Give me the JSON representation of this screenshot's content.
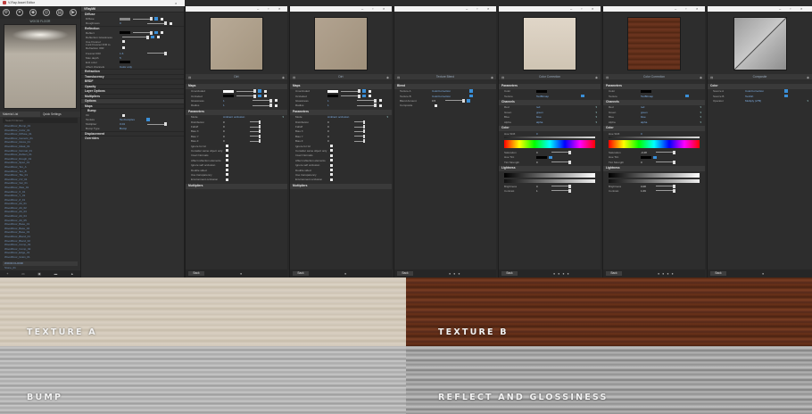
{
  "left_panel": {
    "window_title": "V-Ray Asset Editor",
    "preview_title": "WOOD FLOOR",
    "tabs": [
      "Material List",
      "Quick Settings"
    ],
    "search_placeholder": "Search Names",
    "materials": [
      "WoodFloor_Bump_01",
      "WoodFloor_Color_01",
      "WoodFloor_Diffuse_01",
      "WoodFloor_Generic_01",
      "WoodFloor_Gloss_01",
      "WoodFloor_Mask_01",
      "WoodFloor_Normal_01",
      "WoodFloor_Reflect_01",
      "WoodFloor_Rough_01",
      "WoodFloor_Spec_01",
      "WoodFloor_Tex_A",
      "WoodFloor_Tex_B",
      "WoodFloor_Tile_01",
      "WoodFloor_UV_01",
      "WoodFloor_Var_01",
      "WoodFloor_Wax_01",
      "WoodFloor_X_01",
      "WoodFloor_Y_01",
      "WoodFloor_Z_01",
      "WoodFloor_Alt_01",
      "WoodFloor_Alt_02",
      "WoodFloor_Alt_03",
      "WoodFloor_Alt_04",
      "WoodFloor_Alt_05",
      "WoodFloor_Base_01",
      "WoodFloor_Base_02",
      "WoodFloor_Base_03",
      "WoodFloor_Blend_01",
      "WoodFloor_Blend_02",
      "WoodFloor_Comp_01",
      "WoodFloor_Comp_02",
      "WoodFloor_Edge_01",
      "WoodFloor_Grain_01",
      "WoodFloor_Grain_02"
    ],
    "selected_material": "WOOD FLOOR",
    "last_item": "Stone_01"
  },
  "props": {
    "header": "VRayMtl",
    "sections": {
      "diffuse": "Diffuse",
      "reflection": "Reflection",
      "refraction": "Refraction",
      "translucency": "Translucency",
      "brdf": "BRDF",
      "opacity": "Opacity",
      "layer": "Layer Options",
      "multiplier": "Multipliers",
      "options": "Options",
      "maps": "Maps",
      "bump": "Bump",
      "displacement": "Displacement",
      "overrides": "Overrides"
    },
    "diffuse_label": "Diffuse",
    "roughness_label": "Roughness",
    "roughness_value": "0",
    "reflect_label": "Reflect",
    "refl_gloss_label": "Reflection Glossiness",
    "use_fresnel": "Use Fresnel",
    "lock_fresnel": "Lock Fresnel IOR to Refraction IOR",
    "fresnel_ior_label": "Fresnel IOR",
    "fresnel_ior_value": "1.6",
    "max_depth_label": "Max depth",
    "max_depth_value": "5",
    "exit_color_label": "Exit color",
    "affect_channels_label": "Affect channels",
    "affect_channels_value": "Color only",
    "bump_on": "On",
    "bump_texture_label": "Texture",
    "bump_texture_value": "TexComplex",
    "bump_mult_label": "Multiplier",
    "bump_mult_value": "0.04",
    "bump_type_label": "Bump Type",
    "bump_type_value": "Bump"
  },
  "nodes": [
    {
      "title": "Dirt",
      "sec_maps": "Maps",
      "rows_maps": [
        [
          "Unoccluded",
          "",
          ""
        ],
        [
          "Occluded",
          "",
          ""
        ],
        [
          "Glossiness",
          "1",
          ""
        ],
        [
          "Radius",
          "1",
          ""
        ]
      ],
      "sec_params": "Parameters",
      "rows_params": [
        [
          "Mode",
          "Ambient occlusion"
        ],
        [
          "Distribution",
          "0"
        ],
        [
          "Falloff",
          "0"
        ],
        [
          "Bias X",
          "0"
        ],
        [
          "Bias Y",
          "0"
        ],
        [
          "Bias Z",
          "0"
        ]
      ],
      "checks": [
        "Ignore for GI",
        "Consider same object only",
        "Invert Normals",
        "Affect reflection elements",
        "Ignore self occlusion",
        "Double sided",
        "Use transparency",
        "Environment occlusion"
      ],
      "sec_mult": "Multipliers",
      "back": "Back"
    },
    {
      "title": "Dirt",
      "sec_maps": "Maps",
      "rows_maps": [
        [
          "Unoccluded",
          "",
          ""
        ],
        [
          "Occluded",
          "",
          ""
        ],
        [
          "Glossiness",
          "1",
          ""
        ],
        [
          "Radius",
          "1",
          ""
        ]
      ],
      "sec_params": "Parameters",
      "rows_params": [
        [
          "Mode",
          "Ambient occlusion"
        ],
        [
          "Distribution",
          "0"
        ],
        [
          "Falloff",
          "0"
        ],
        [
          "Bias X",
          "0"
        ],
        [
          "Bias Y",
          "0"
        ],
        [
          "Bias Z",
          "0"
        ]
      ],
      "checks": [
        "Ignore for GI",
        "Consider same object only",
        "Invert Normals",
        "Affect reflection elements",
        "Ignore self occlusion",
        "Double sided",
        "Use transparency",
        "Environment occlusion"
      ],
      "sec_mult": "Multipliers",
      "back": "Back"
    },
    {
      "title": "Texture Blend",
      "sec_blend": "Blend",
      "rows": [
        [
          "Texture A",
          "ColorCorrection"
        ],
        [
          "Texture B",
          "ColorCorrection"
        ],
        [
          "Blend Amount",
          "0.5"
        ],
        [
          "Composite",
          ""
        ]
      ],
      "back": "Back"
    },
    {
      "title": "Color Correction",
      "sec_params": "Parameters",
      "color_label": "Color",
      "texture_label": "Texture",
      "texture_value": "TexBitmap",
      "sec_channels": "Channels",
      "channels": [
        [
          "Red",
          "red"
        ],
        [
          "Green",
          "green"
        ],
        [
          "Blue",
          "blue"
        ],
        [
          "Alpha",
          "alpha"
        ]
      ],
      "sec_color": "Color",
      "hue_label": "Hue Shift",
      "hue_value": "0",
      "sat_label": "Saturation",
      "sat_value": "0",
      "tint_label": "Hue Tint",
      "tint_str_label": "Tint Strength",
      "tint_str_value": "0",
      "sec_light": "Lightness",
      "bright_label": "Brightness",
      "bright_value": "0",
      "contrast_label": "Contrast",
      "contrast_value": "1",
      "back": "Back"
    },
    {
      "title": "Color Correction",
      "sec_params": "Parameters",
      "color_label": "Color",
      "texture_label": "Texture",
      "texture_value": "TexBitmap",
      "sec_channels": "Channels",
      "channels": [
        [
          "Red",
          "red"
        ],
        [
          "Green",
          "green"
        ],
        [
          "Blue",
          "blue"
        ],
        [
          "Alpha",
          "alpha"
        ]
      ],
      "sec_color": "Color",
      "hue_label": "Hue Shift",
      "hue_value": "0",
      "sat_label": "Saturation",
      "sat_value": "-0.28",
      "tint_label": "Hue Tint",
      "tint_str_label": "Tint Strength",
      "tint_str_value": "0",
      "sec_light": "Lightness",
      "bright_label": "Brightness",
      "bright_value": "0.08",
      "contrast_label": "Contrast",
      "contrast_value": "1.09",
      "back": "Back"
    },
    {
      "title": "Composite",
      "sec_color": "Color",
      "rows": [
        [
          "Source A",
          "ColorCorrection"
        ],
        [
          "Source B",
          "TexDirt"
        ],
        [
          "Operator",
          "Multiply (A*B)"
        ]
      ],
      "back": "Back"
    }
  ],
  "strips": {
    "a": "TEXTURE A",
    "b": "TEXTURE B",
    "c": "BUMP",
    "d": "REFLECT AND GLOSSINESS"
  },
  "colors": {
    "accent": "#3a8fd8",
    "link_text": "#7fb0e6"
  }
}
